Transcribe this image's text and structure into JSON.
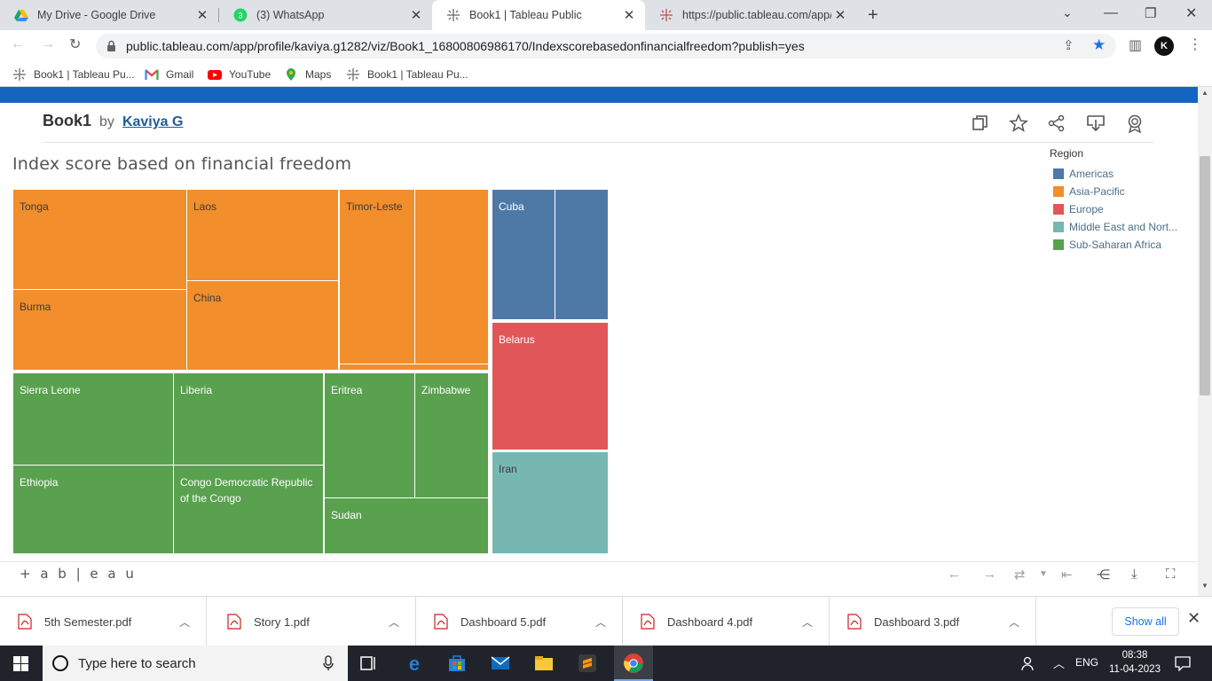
{
  "browser": {
    "tabs": [
      {
        "title": "My Drive - Google Drive",
        "icon": "google-drive-icon"
      },
      {
        "title": "(3) WhatsApp",
        "icon": "whatsapp-icon"
      },
      {
        "title": "Book1 | Tableau Public",
        "icon": "tableau-icon",
        "active": true
      },
      {
        "title": "https://public.tableau.com/app/p",
        "icon": "tableau-icon"
      }
    ],
    "url": "public.tableau.com/app/profile/kaviya.g1282/viz/Book1_16800806986170/Indexscorebasedonfinancialfreedom?publish=yes",
    "bookmarks": [
      "Book1 | Tableau Pu...",
      "Gmail",
      "YouTube",
      "Maps",
      "Book1 | Tableau Pu..."
    ],
    "profile_initial": "K"
  },
  "viz": {
    "book": "Book1",
    "by": "by",
    "author": "Kaviya G",
    "title": "Index score based on financial freedom",
    "legend_title": "Region",
    "footer_logo": "+ a b | e a u"
  },
  "chart_data": {
    "type": "treemap",
    "title": "Index score based on financial freedom",
    "color_by": "Region",
    "legend": [
      {
        "name": "Americas",
        "color": "#4e79a7"
      },
      {
        "name": "Asia-Pacific",
        "color": "#f28e2b"
      },
      {
        "name": "Europe",
        "color": "#e15759"
      },
      {
        "name": "Middle East and Nort...",
        "color": "#76b7b2"
      },
      {
        "name": "Sub-Saharan Africa",
        "color": "#59a14f"
      }
    ],
    "labels": [
      {
        "text": "Tonga",
        "region": "Asia-Pacific"
      },
      {
        "text": "Laos",
        "region": "Asia-Pacific"
      },
      {
        "text": "Timor-Leste",
        "region": "Asia-Pacific"
      },
      {
        "text": "",
        "region": "Asia-Pacific"
      },
      {
        "text": "Burma",
        "region": "Asia-Pacific"
      },
      {
        "text": "China",
        "region": "Asia-Pacific"
      },
      {
        "text": "",
        "region": "Asia-Pacific"
      },
      {
        "text": "Cuba",
        "region": "Americas"
      },
      {
        "text": "",
        "region": "Americas"
      },
      {
        "text": "Belarus",
        "region": "Europe"
      },
      {
        "text": "Iran",
        "region": "Middle East and Nort..."
      },
      {
        "text": "Sierra Leone",
        "region": "Sub-Saharan Africa"
      },
      {
        "text": "Liberia",
        "region": "Sub-Saharan Africa"
      },
      {
        "text": "Eritrea",
        "region": "Sub-Saharan Africa"
      },
      {
        "text": "Zimbabwe",
        "region": "Sub-Saharan Africa"
      },
      {
        "text": "Ethiopia",
        "region": "Sub-Saharan Africa"
      },
      {
        "text": "Congo Democratic Republic of the Congo",
        "region": "Sub-Saharan Africa"
      },
      {
        "text": "Sudan",
        "region": "Sub-Saharan Africa"
      }
    ]
  },
  "downloads": [
    {
      "name": "5th Semester.pdf"
    },
    {
      "name": "Story 1.pdf"
    },
    {
      "name": "Dashboard 5.pdf"
    },
    {
      "name": "Dashboard 4.pdf"
    },
    {
      "name": "Dashboard 3.pdf"
    }
  ],
  "downloads_show_all": "Show all",
  "taskbar": {
    "search_placeholder": "Type here to search",
    "lang": "ENG",
    "time": "08:38",
    "date": "11-04-2023"
  }
}
